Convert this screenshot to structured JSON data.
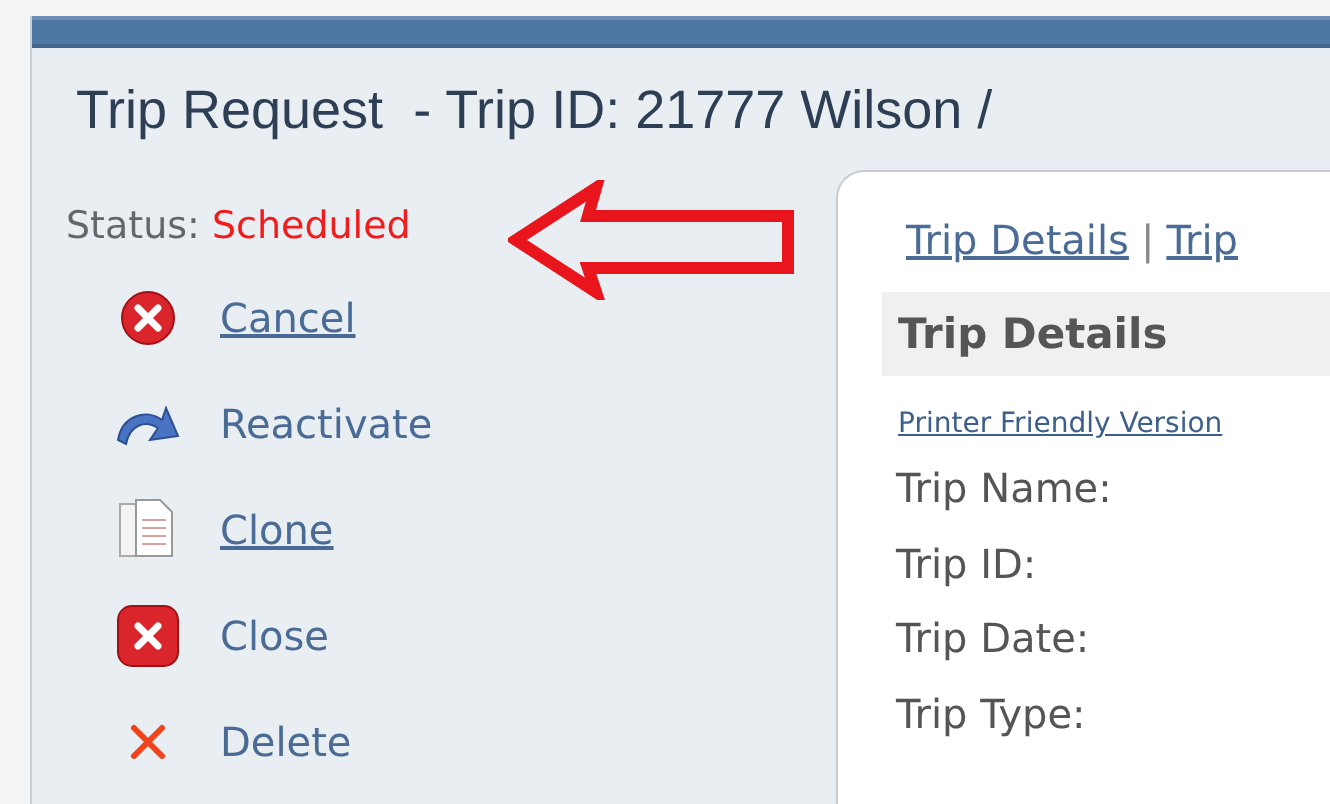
{
  "title": "Trip Request  - Trip ID: 21777 Wilson /",
  "status": {
    "label": "Status:",
    "value": "Scheduled"
  },
  "actions": [
    {
      "label": "Cancel",
      "disabled": false
    },
    {
      "label": "Reactivate",
      "disabled": true
    },
    {
      "label": "Clone",
      "disabled": false
    },
    {
      "label": "Close",
      "disabled": true
    },
    {
      "label": "Delete",
      "disabled": true
    }
  ],
  "tabs": [
    {
      "label": "Trip Details"
    },
    {
      "label": "Trip"
    }
  ],
  "tab_separator": "|",
  "section": {
    "heading": "Trip Details",
    "printer_link": "Printer Friendly Version",
    "fields": [
      "Trip Name:",
      "Trip ID:",
      "Trip Date:",
      "Trip Type:"
    ]
  }
}
